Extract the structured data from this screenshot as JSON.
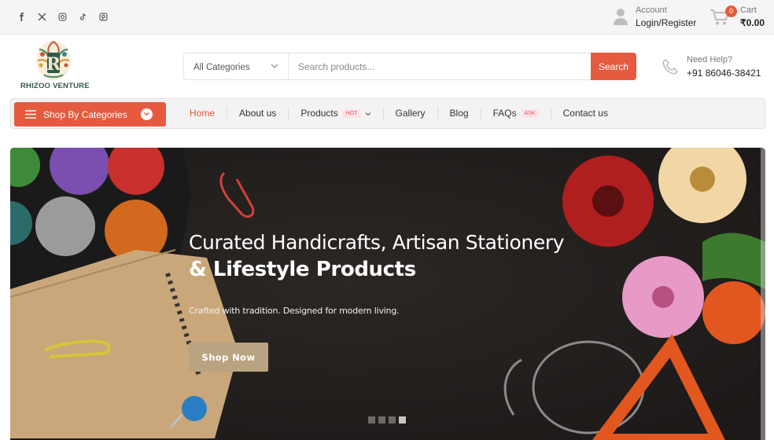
{
  "topbar": {
    "social_icons": [
      "facebook-icon",
      "x-icon",
      "instagram-icon",
      "tiktok-icon",
      "pinterest-icon"
    ],
    "account": {
      "label": "Account",
      "action": "Login/Register",
      "icon": "user-icon"
    },
    "cart": {
      "label": "Cart",
      "total": "₹0.00",
      "count": "0",
      "icon": "cart-icon"
    }
  },
  "header": {
    "brand": "RHIZOO VENTURE",
    "search": {
      "category": "All Categories",
      "placeholder": "Search products...",
      "button": "Search"
    },
    "help": {
      "label": "Need Help?",
      "phone": "+91 86046-38421",
      "icon": "phone-icon"
    }
  },
  "nav": {
    "shop_by_categories": "Shop By Categories",
    "links": [
      {
        "label": "Home",
        "active": true
      },
      {
        "label": "About us"
      },
      {
        "label": "Products",
        "tag": "HOT",
        "dropdown": true
      },
      {
        "label": "Gallery"
      },
      {
        "label": "Blog"
      },
      {
        "label": "FAQs",
        "tag": "ASK"
      },
      {
        "label": "Contact us"
      }
    ]
  },
  "hero": {
    "title_line1": "Curated Handicrafts, Artisan Stationery",
    "title_line2": "& Lifestyle Products",
    "subtitle": "Crafted with tradition. Designed for modern living.",
    "cta": "Shop Now",
    "slides": 4,
    "active_slide": 4
  },
  "colors": {
    "accent": "#e65a3f",
    "cta": "#b9a482",
    "brand_text": "#2f5a4f"
  }
}
